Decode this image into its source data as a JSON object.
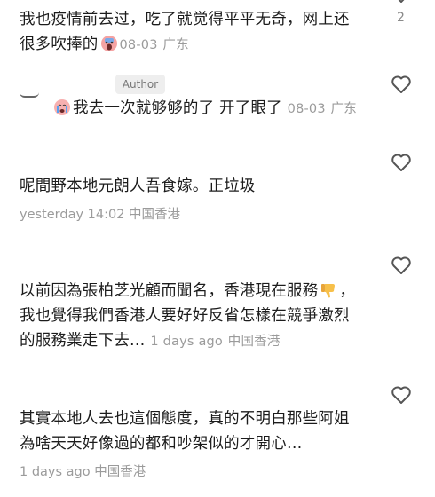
{
  "comments": [
    {
      "text_line1": "我也疫情前去过，吃了就觉得平平无奇，网上还",
      "text_line2": "很多吹捧的",
      "emoji_icon": "screaming-face-emoji",
      "date": "08-03",
      "location": "广东",
      "likes": "2"
    },
    {
      "author_badge": "Author",
      "emoji_icon": "crying-face-emoji",
      "text": "我去一次就够够的了 开了眼了",
      "date": "08-03",
      "location": "广东"
    },
    {
      "text": "呢間野本地元朗人吾食嫁。正垃圾",
      "time": "yesterday 14:02",
      "location": "中国香港"
    },
    {
      "text_line1": "以前因為張柏芝光顧而聞名，香港現在服務",
      "text_line1_suffix": "，",
      "emoji_icon": "thumbs-down-emoji",
      "text_line2": "我也覺得我們香港人要好好反省怎樣在競爭激烈",
      "text_line3": "的服務業走下去…",
      "time": "1 days ago",
      "location": "中国香港"
    },
    {
      "text_line1": "其實本地人去也這個態度，真的不明白那些阿姐",
      "text_line2": "為啥天天好像過的都和吵架似的才開心…",
      "time": "1 days ago",
      "location": "中国香港"
    }
  ]
}
